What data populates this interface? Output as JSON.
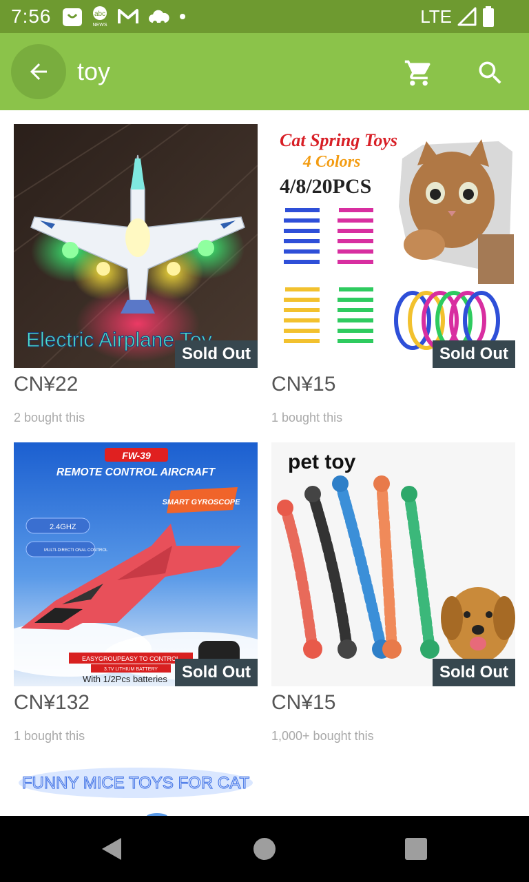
{
  "status_bar": {
    "time": "7:56",
    "network": "LTE",
    "icons": [
      "shopping-bag-icon",
      "abc-news-icon",
      "gmail-icon",
      "cloud-icon",
      "dot-icon",
      "signal-icon",
      "battery-icon"
    ],
    "news_label": "abc"
  },
  "app_bar": {
    "search_query": "toy",
    "color": "#8bc34a",
    "icons": [
      "arrow-back-icon",
      "shopping-cart-icon",
      "search-icon"
    ]
  },
  "products": [
    {
      "price": "CN¥22",
      "bought": "2 bought this",
      "badge": "Sold Out",
      "image_text": "Electric Airplane Toy"
    },
    {
      "price": "CN¥15",
      "bought": "1 bought this",
      "badge": "Sold Out",
      "image_text": {
        "title": "Cat Spring Toys",
        "subtitle": "4 Colors",
        "count": "4/8/20PCS"
      }
    },
    {
      "price": "CN¥132",
      "bought": "1 bought this",
      "badge": "Sold Out",
      "image_text": {
        "model": "FW-39",
        "title": "REMOTE CONTROL AIRCRAFT",
        "feature": "SMART GYROSCOPE",
        "spec1": "2.4GHZ",
        "spec2": "MULTI-DIRECTI ONAL CONTROL",
        "brand": "EASYGROUPEASY TO CONTROL",
        "battery": "3.7V LITHIUM BATTERY",
        "batteries": "With 1/2Pcs batteries"
      }
    },
    {
      "price": "CN¥15",
      "bought": "1,000+ bought this",
      "badge": "Sold Out",
      "image_text": "pet toy"
    }
  ],
  "partial_product": {
    "image_text": "FUNNY MICE TOYS FOR CAT"
  },
  "nav_bar": {
    "icons": [
      "nav-back-icon",
      "nav-home-icon",
      "nav-recents-icon"
    ]
  }
}
